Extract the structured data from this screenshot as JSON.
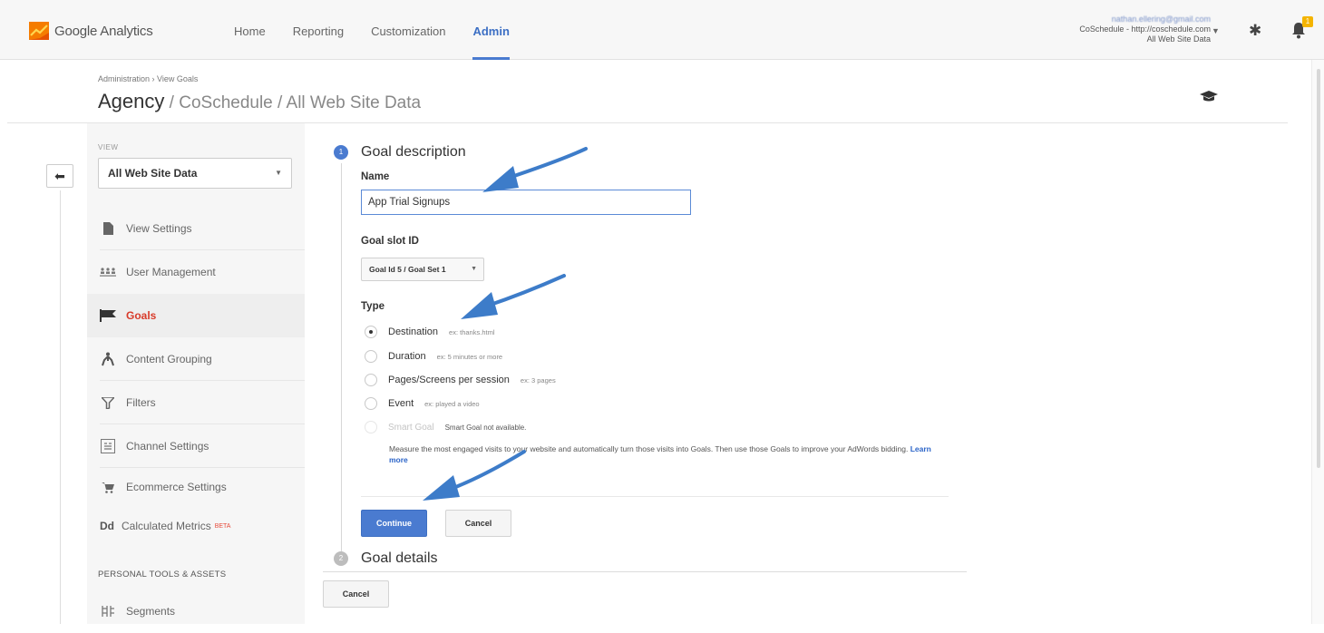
{
  "app": {
    "name": "Google Analytics",
    "brand_color": "#f57c00"
  },
  "nav": {
    "items": [
      {
        "label": "Home"
      },
      {
        "label": "Reporting"
      },
      {
        "label": "Customization"
      },
      {
        "label": "Admin"
      }
    ],
    "active": "Admin",
    "accent": "#4a7bd0"
  },
  "account": {
    "email": "nathan.ellering@gmail.com",
    "property": "CoSchedule - http://coschedule.com",
    "view": "All Web Site Data",
    "notifications": "1"
  },
  "header": {
    "breadcrumb": "Administration › View Goals",
    "title_main": "Agency",
    "title_rest": " / CoSchedule / All Web Site Data"
  },
  "sidebar": {
    "view_label": "VIEW",
    "view_value": "All Web Site Data",
    "items": [
      {
        "label": "View Settings"
      },
      {
        "label": "User Management"
      },
      {
        "label": "Goals"
      },
      {
        "label": "Content Grouping"
      },
      {
        "label": "Filters"
      },
      {
        "label": "Channel Settings"
      },
      {
        "label": "Ecommerce Settings"
      },
      {
        "label": "Calculated Metrics",
        "badge": "BETA"
      },
      {
        "label": "Segments"
      }
    ],
    "section_label": "PERSONAL TOOLS & ASSETS",
    "calculated_metrics_prefix": "Dd"
  },
  "form": {
    "step1_number": "1",
    "step1_title": "Goal description",
    "name_label": "Name",
    "name_value": "App Trial Signups",
    "slot_label": "Goal slot ID",
    "slot_value": "Goal Id 5 / Goal Set 1",
    "type_label": "Type",
    "types": [
      {
        "label": "Destination",
        "example": "ex: thanks.html",
        "checked": true
      },
      {
        "label": "Duration",
        "example": "ex: 5 minutes or more",
        "checked": false
      },
      {
        "label": "Pages/Screens per session",
        "example": "ex: 3 pages",
        "checked": false
      },
      {
        "label": "Event",
        "example": "ex: played a video",
        "checked": false
      },
      {
        "label": "Smart Goal",
        "example": "Smart Goal not available.",
        "checked": false,
        "disabled": true
      }
    ],
    "smart_desc_1": "Measure the most engaged visits to your website and automatically turn those visits into Goals. Then use those Goals to improve your AdWords bidding.",
    "learn_more": "Learn more",
    "continue_label": "Continue",
    "cancel_label": "Cancel",
    "step2_number": "2",
    "step2_title": "Goal details",
    "cancel_bottom_label": "Cancel"
  },
  "annotations": {
    "arrow_color": "#3d7cc9"
  }
}
